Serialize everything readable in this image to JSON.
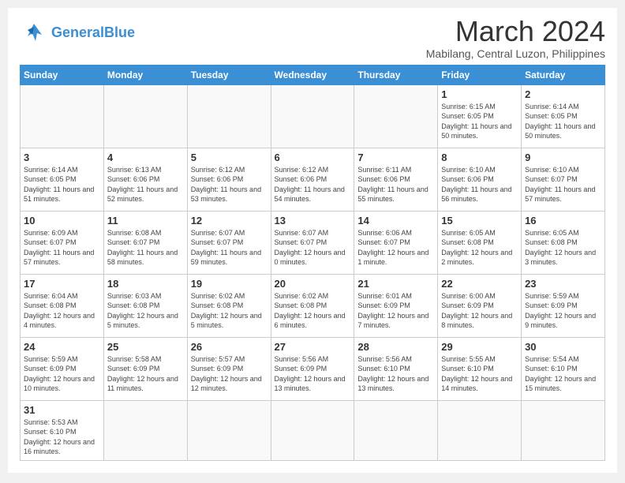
{
  "header": {
    "logo_general": "General",
    "logo_blue": "Blue",
    "month_title": "March 2024",
    "location": "Mabilang, Central Luzon, Philippines"
  },
  "days_of_week": [
    "Sunday",
    "Monday",
    "Tuesday",
    "Wednesday",
    "Thursday",
    "Friday",
    "Saturday"
  ],
  "weeks": [
    [
      {
        "day": "",
        "info": ""
      },
      {
        "day": "",
        "info": ""
      },
      {
        "day": "",
        "info": ""
      },
      {
        "day": "",
        "info": ""
      },
      {
        "day": "",
        "info": ""
      },
      {
        "day": "1",
        "info": "Sunrise: 6:15 AM\nSunset: 6:05 PM\nDaylight: 11 hours\nand 50 minutes."
      },
      {
        "day": "2",
        "info": "Sunrise: 6:14 AM\nSunset: 6:05 PM\nDaylight: 11 hours\nand 50 minutes."
      }
    ],
    [
      {
        "day": "3",
        "info": "Sunrise: 6:14 AM\nSunset: 6:05 PM\nDaylight: 11 hours\nand 51 minutes."
      },
      {
        "day": "4",
        "info": "Sunrise: 6:13 AM\nSunset: 6:06 PM\nDaylight: 11 hours\nand 52 minutes."
      },
      {
        "day": "5",
        "info": "Sunrise: 6:12 AM\nSunset: 6:06 PM\nDaylight: 11 hours\nand 53 minutes."
      },
      {
        "day": "6",
        "info": "Sunrise: 6:12 AM\nSunset: 6:06 PM\nDaylight: 11 hours\nand 54 minutes."
      },
      {
        "day": "7",
        "info": "Sunrise: 6:11 AM\nSunset: 6:06 PM\nDaylight: 11 hours\nand 55 minutes."
      },
      {
        "day": "8",
        "info": "Sunrise: 6:10 AM\nSunset: 6:06 PM\nDaylight: 11 hours\nand 56 minutes."
      },
      {
        "day": "9",
        "info": "Sunrise: 6:10 AM\nSunset: 6:07 PM\nDaylight: 11 hours\nand 57 minutes."
      }
    ],
    [
      {
        "day": "10",
        "info": "Sunrise: 6:09 AM\nSunset: 6:07 PM\nDaylight: 11 hours\nand 57 minutes."
      },
      {
        "day": "11",
        "info": "Sunrise: 6:08 AM\nSunset: 6:07 PM\nDaylight: 11 hours\nand 58 minutes."
      },
      {
        "day": "12",
        "info": "Sunrise: 6:07 AM\nSunset: 6:07 PM\nDaylight: 11 hours\nand 59 minutes."
      },
      {
        "day": "13",
        "info": "Sunrise: 6:07 AM\nSunset: 6:07 PM\nDaylight: 12 hours\nand 0 minutes."
      },
      {
        "day": "14",
        "info": "Sunrise: 6:06 AM\nSunset: 6:07 PM\nDaylight: 12 hours\nand 1 minute."
      },
      {
        "day": "15",
        "info": "Sunrise: 6:05 AM\nSunset: 6:08 PM\nDaylight: 12 hours\nand 2 minutes."
      },
      {
        "day": "16",
        "info": "Sunrise: 6:05 AM\nSunset: 6:08 PM\nDaylight: 12 hours\nand 3 minutes."
      }
    ],
    [
      {
        "day": "17",
        "info": "Sunrise: 6:04 AM\nSunset: 6:08 PM\nDaylight: 12 hours\nand 4 minutes."
      },
      {
        "day": "18",
        "info": "Sunrise: 6:03 AM\nSunset: 6:08 PM\nDaylight: 12 hours\nand 5 minutes."
      },
      {
        "day": "19",
        "info": "Sunrise: 6:02 AM\nSunset: 6:08 PM\nDaylight: 12 hours\nand 5 minutes."
      },
      {
        "day": "20",
        "info": "Sunrise: 6:02 AM\nSunset: 6:08 PM\nDaylight: 12 hours\nand 6 minutes."
      },
      {
        "day": "21",
        "info": "Sunrise: 6:01 AM\nSunset: 6:09 PM\nDaylight: 12 hours\nand 7 minutes."
      },
      {
        "day": "22",
        "info": "Sunrise: 6:00 AM\nSunset: 6:09 PM\nDaylight: 12 hours\nand 8 minutes."
      },
      {
        "day": "23",
        "info": "Sunrise: 5:59 AM\nSunset: 6:09 PM\nDaylight: 12 hours\nand 9 minutes."
      }
    ],
    [
      {
        "day": "24",
        "info": "Sunrise: 5:59 AM\nSunset: 6:09 PM\nDaylight: 12 hours\nand 10 minutes."
      },
      {
        "day": "25",
        "info": "Sunrise: 5:58 AM\nSunset: 6:09 PM\nDaylight: 12 hours\nand 11 minutes."
      },
      {
        "day": "26",
        "info": "Sunrise: 5:57 AM\nSunset: 6:09 PM\nDaylight: 12 hours\nand 12 minutes."
      },
      {
        "day": "27",
        "info": "Sunrise: 5:56 AM\nSunset: 6:09 PM\nDaylight: 12 hours\nand 13 minutes."
      },
      {
        "day": "28",
        "info": "Sunrise: 5:56 AM\nSunset: 6:10 PM\nDaylight: 12 hours\nand 13 minutes."
      },
      {
        "day": "29",
        "info": "Sunrise: 5:55 AM\nSunset: 6:10 PM\nDaylight: 12 hours\nand 14 minutes."
      },
      {
        "day": "30",
        "info": "Sunrise: 5:54 AM\nSunset: 6:10 PM\nDaylight: 12 hours\nand 15 minutes."
      }
    ],
    [
      {
        "day": "31",
        "info": "Sunrise: 5:53 AM\nSunset: 6:10 PM\nDaylight: 12 hours\nand 16 minutes."
      },
      {
        "day": "",
        "info": ""
      },
      {
        "day": "",
        "info": ""
      },
      {
        "day": "",
        "info": ""
      },
      {
        "day": "",
        "info": ""
      },
      {
        "day": "",
        "info": ""
      },
      {
        "day": "",
        "info": ""
      }
    ]
  ]
}
